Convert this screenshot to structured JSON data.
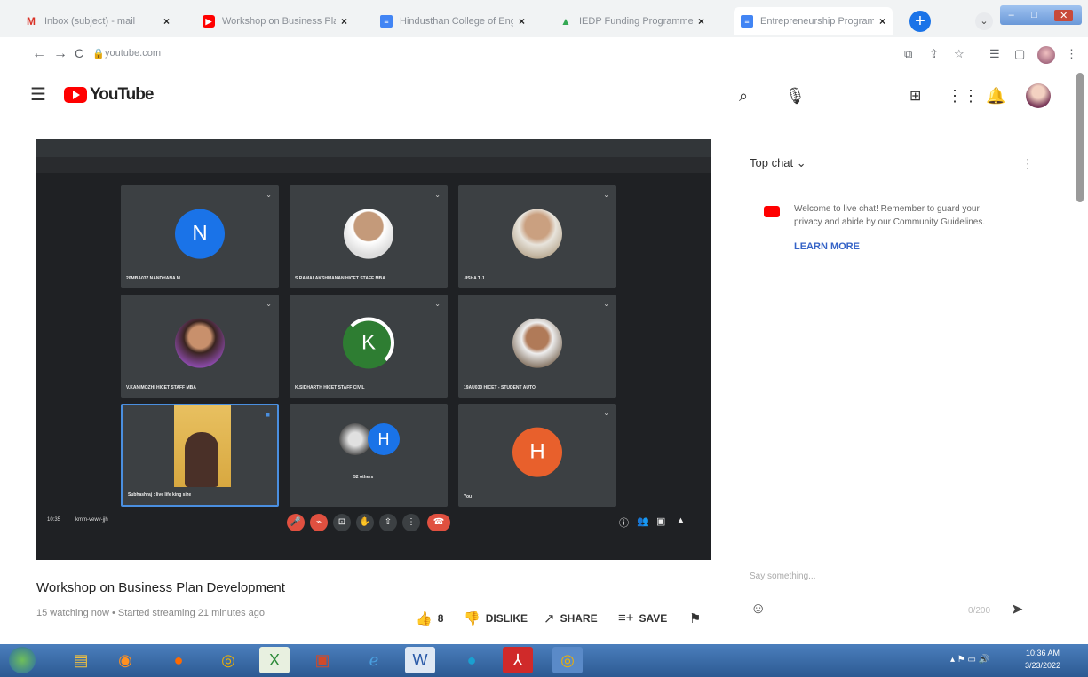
{
  "browser": {
    "tabs": [
      {
        "title": "Inbox (subject) - mail",
        "icon": "gmail-icon"
      },
      {
        "title": "Workshop on Business Plan",
        "icon": "youtube-icon"
      },
      {
        "title": "Hindusthan College of Engine",
        "icon": "docs-icon"
      },
      {
        "title": "IEDP Funding Programme",
        "icon": "drive-icon"
      },
      {
        "title": "Entrepreneurship Programme",
        "icon": "docs-icon"
      }
    ],
    "new_tab": "+",
    "url": "youtube.com"
  },
  "youtube": {
    "logo": "YouTube"
  },
  "meet": {
    "participants": [
      {
        "initial": "N",
        "name": "20MBA037 NANDHANA M",
        "color": "#1a73e8"
      },
      {
        "initial": "",
        "name": "S.RAMALAKSHMANAN HICET STAFF MBA",
        "color": ""
      },
      {
        "initial": "",
        "name": "JISHA T J",
        "color": ""
      },
      {
        "initial": "",
        "name": "V.KANIMOZHI HICET STAFF MBA",
        "color": ""
      },
      {
        "initial": "K",
        "name": "K.SIDHARTH HICET STAFF CIVIL",
        "color": "#2e7d32"
      },
      {
        "initial": "",
        "name": "19AU030 HICET - STUDENT AUTO",
        "color": ""
      },
      {
        "initial": "",
        "name": "Subhashraj : live life king size",
        "color": ""
      },
      {
        "initial": "H",
        "name": "52 others",
        "color": "#1a73e8"
      },
      {
        "initial": "H",
        "name": "You",
        "color": "#e8602c"
      }
    ],
    "time": "10:35",
    "meeting_code": "kmm-vewv-jjh"
  },
  "video": {
    "title": "Workshop on Business Plan Development",
    "meta": "15 watching now • Started streaming 21 minutes ago",
    "like_count": "8",
    "dislike": "DISLIKE",
    "share": "SHARE",
    "save": "SAVE"
  },
  "chat": {
    "header": "Top chat",
    "welcome": "Welcome to live chat! Remember to guard your privacy and abide by our Community Guidelines.",
    "learn_more": "LEARN MORE",
    "input_placeholder": "Say something...",
    "counter": "0/200"
  },
  "taskbar": {
    "time": "10:36 AM",
    "date": "3/23/2022"
  }
}
